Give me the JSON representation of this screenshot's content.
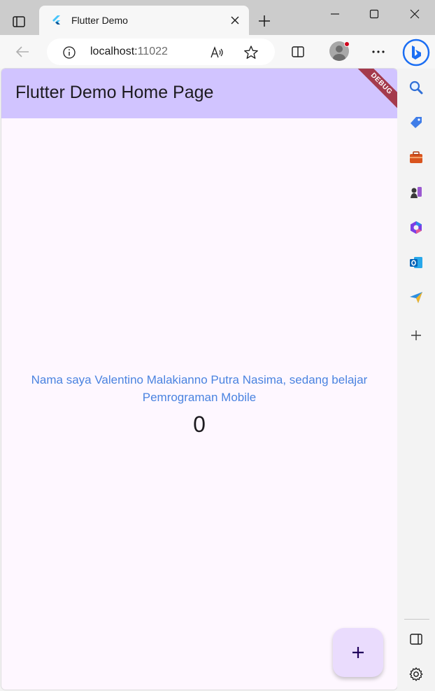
{
  "browser": {
    "tab": {
      "title": "Flutter Demo"
    },
    "address": {
      "host": "localhost:",
      "port": "11022"
    }
  },
  "app": {
    "appbar_title": "Flutter Demo Home Page",
    "debug_banner": "DEBUG",
    "message": "Nama saya Valentino Malakianno Putra Nasima, sedang belajar Pemrograman Mobile",
    "counter": "0",
    "fab_label": "+"
  },
  "colors": {
    "appbar": "#d1c4ff",
    "page_background": "#fef7ff",
    "message_text": "#4a83e0",
    "fab": "#eadcfd",
    "debug_ribbon": "#a43a4c"
  },
  "sidebar": {
    "items": [
      "search-icon",
      "shopping-tag-icon",
      "tools-briefcase-icon",
      "games-chess-icon",
      "microsoft-365-icon",
      "outlook-icon",
      "drop-send-icon",
      "add-icon"
    ],
    "bottom": [
      "sidebar-toggle-icon",
      "settings-gear-icon"
    ]
  }
}
